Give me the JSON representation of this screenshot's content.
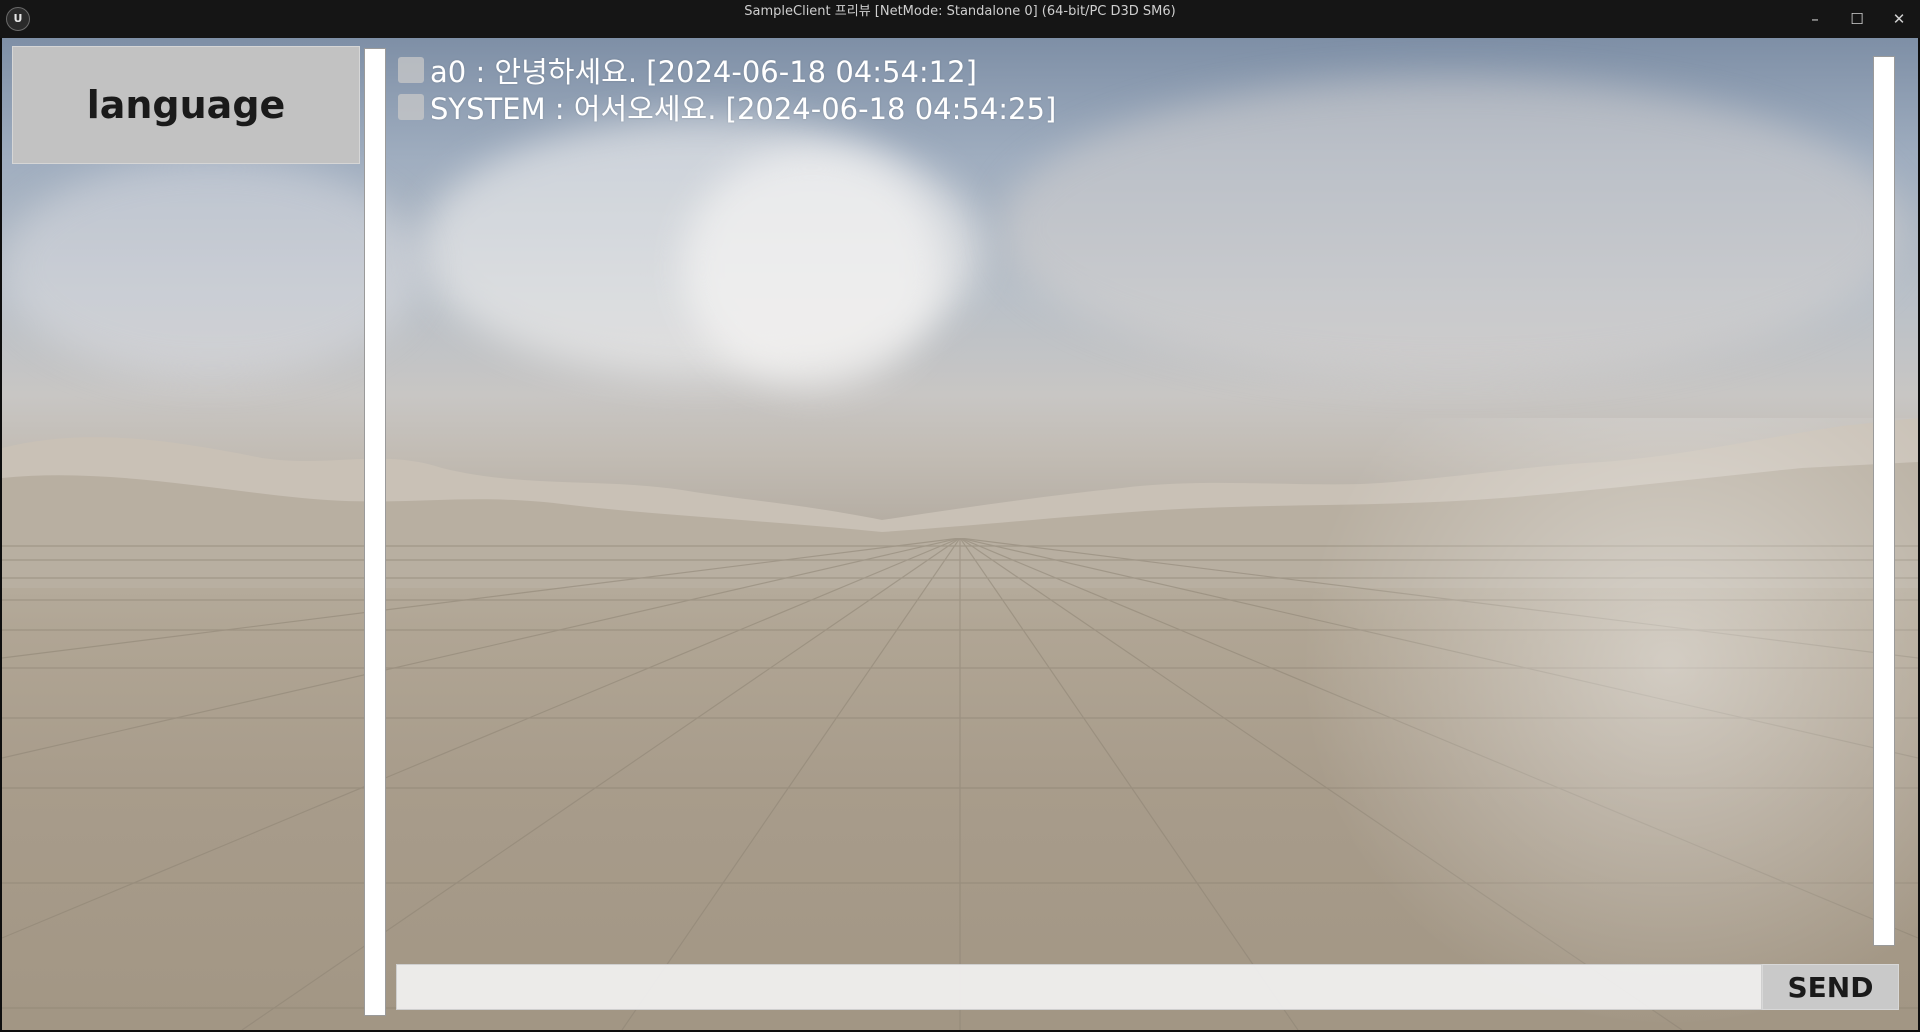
{
  "window": {
    "logo": "U",
    "title": "SampleClient 프리뷰 [NetMode: Standalone 0]  (64-bit/PC D3D SM6)",
    "controls": {
      "minimize": "–",
      "maximize": "☐",
      "close": "✕"
    }
  },
  "sidebar": {
    "language_button": "language"
  },
  "chat": {
    "messages": [
      {
        "text": "a0 : 안녕하세요. [2024-06-18 04:54:12]"
      },
      {
        "text": "SYSTEM : 어서오세요. [2024-06-18 04:54:25]"
      }
    ]
  },
  "composer": {
    "input_value": "",
    "input_placeholder": "",
    "send_label": "SEND"
  },
  "colors": {
    "panel_button": "#c2c2c2",
    "scrollbar": "#ffffff",
    "chat_text": "#ffffff"
  }
}
